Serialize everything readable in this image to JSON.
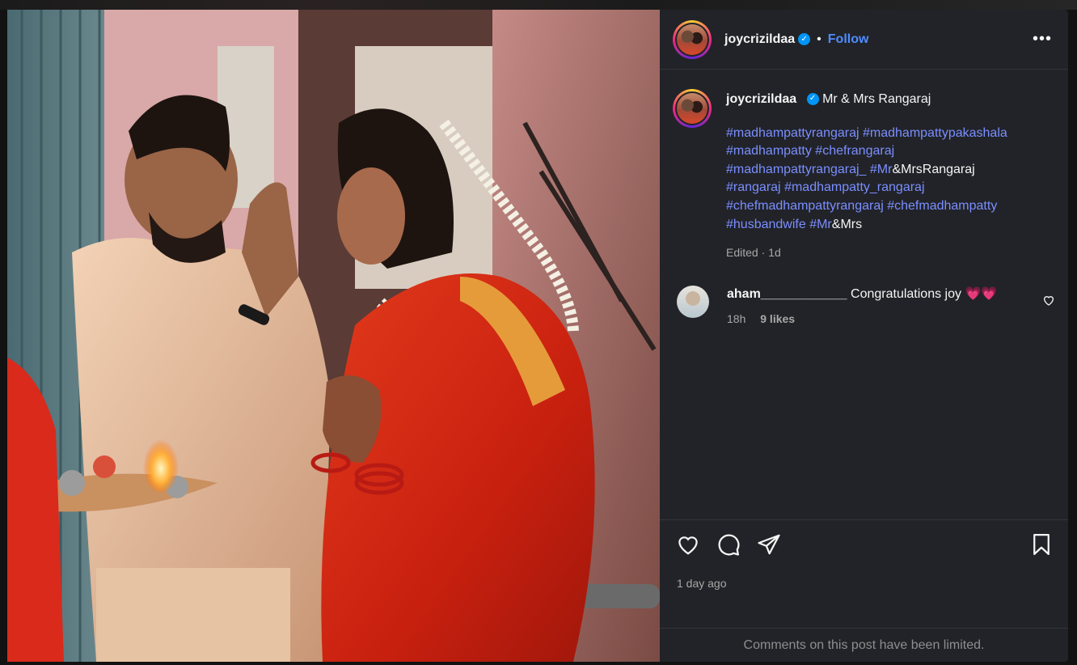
{
  "post": {
    "username": "joycrizildaa",
    "verified_symbol": "✓",
    "separator": "•",
    "follow_label": "Follow",
    "more_label": "•••",
    "caption_text": "Mr & Mrs Rangaraj",
    "hashtag_lines": [
      [
        {
          "text": "#madhampattyrangaraj",
          "tag": true
        },
        {
          "text": " ",
          "tag": false
        },
        {
          "text": "#madhampattypakashala",
          "tag": true
        }
      ],
      [
        {
          "text": "#madhampatty",
          "tag": true
        },
        {
          "text": " ",
          "tag": false
        },
        {
          "text": "#chefrangaraj",
          "tag": true
        }
      ],
      [
        {
          "text": "#madhampattyrangaraj_",
          "tag": true
        },
        {
          "text": " ",
          "tag": false
        },
        {
          "text": "#Mr",
          "tag": true
        },
        {
          "text": "&MrsRangaraj",
          "tag": false
        }
      ],
      [
        {
          "text": "#rangaraj",
          "tag": true
        },
        {
          "text": " ",
          "tag": false
        },
        {
          "text": "#madhampatty_rangaraj",
          "tag": true
        }
      ],
      [
        {
          "text": "#chefmadhampattyrangaraj",
          "tag": true
        },
        {
          "text": " ",
          "tag": false
        },
        {
          "text": "#chefmadhampatty",
          "tag": true
        }
      ],
      [
        {
          "text": "#husbandwife",
          "tag": true
        },
        {
          "text": " ",
          "tag": false
        },
        {
          "text": "#Mr",
          "tag": true
        },
        {
          "text": "&Mrs",
          "tag": false
        }
      ]
    ],
    "edited_label": "Edited",
    "edited_sep": " · ",
    "edited_time": "1d",
    "date_label": "1 day ago",
    "comments_limited": "Comments on this post have been limited."
  },
  "comment": {
    "username": "aham____________",
    "text": " Congratulations joy 💗💗",
    "time": "18h",
    "likes": "9 likes"
  },
  "icons": {
    "like": "heart-icon",
    "comment": "comment-bubble-icon",
    "share": "paper-plane-icon",
    "save": "bookmark-icon"
  },
  "colors": {
    "panel_bg": "#212328",
    "link_blue": "#4f8cff",
    "hashtag": "#7b8eff",
    "muted": "#a8a8a8"
  }
}
